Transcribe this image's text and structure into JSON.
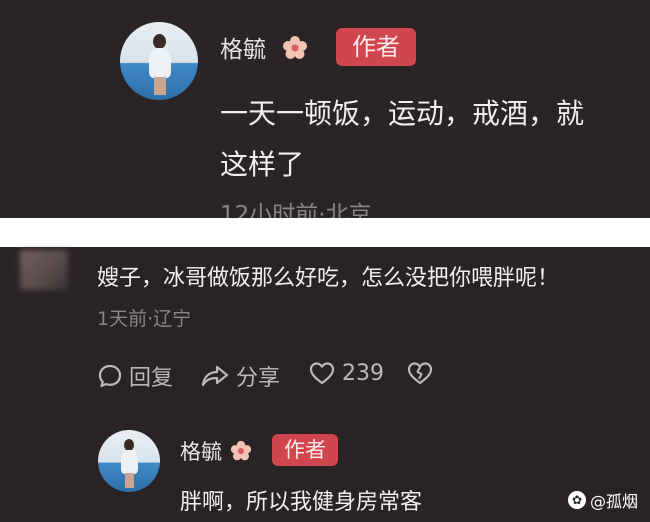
{
  "top_comment": {
    "username": "格毓",
    "author_badge": "作者",
    "text_line1": "一天一顿饭，运动，戒酒，就",
    "text_line2": "这样了",
    "meta": "12小时前·北京",
    "avatar_icon": "avatar-photo"
  },
  "reply_comment": {
    "text": "嫂子，冰哥做饭那么好吃，怎么没把你喂胖呢！",
    "meta": "1天前·辽宁",
    "actions": {
      "reply_label": "回复",
      "share_label": "分享",
      "like_count": "239"
    }
  },
  "author_reply": {
    "username": "格毓",
    "author_badge": "作者",
    "text": "胖啊，所以我健身房常客"
  },
  "watermark": {
    "text": "@孤烟"
  },
  "colors": {
    "background": "#2b2426",
    "badge": "#d0464f",
    "text": "#f1eeee",
    "meta": "#8b8486"
  }
}
